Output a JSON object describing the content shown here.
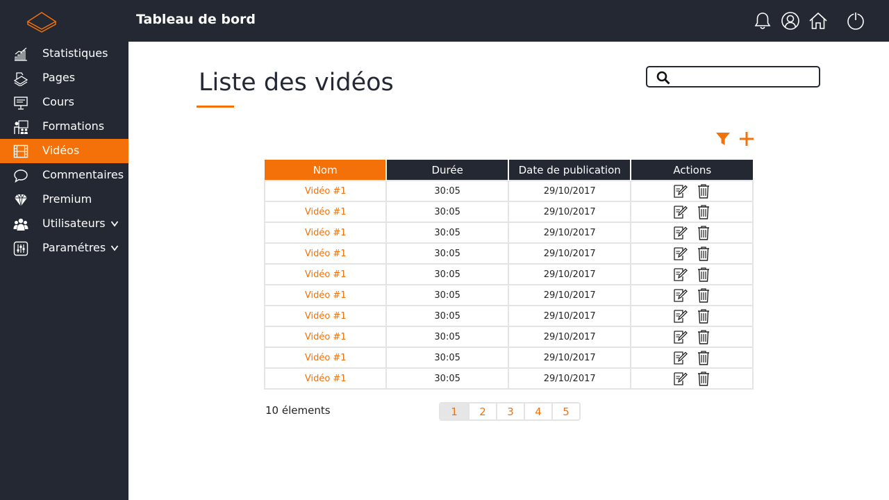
{
  "header": {
    "title": "Tableau de bord"
  },
  "sidebar": {
    "items": [
      {
        "label": "Statistiques",
        "icon": "chart-icon"
      },
      {
        "label": "Pages",
        "icon": "pages-icon"
      },
      {
        "label": "Cours",
        "icon": "presentation-icon"
      },
      {
        "label": "Formations",
        "icon": "training-icon"
      },
      {
        "label": "Vidéos",
        "icon": "film-icon",
        "active": true
      },
      {
        "label": "Commentaires",
        "icon": "comment-icon"
      },
      {
        "label": "Premium",
        "icon": "diamond-icon"
      },
      {
        "label": "Utilisateurs",
        "icon": "users-icon",
        "has_submenu": true
      },
      {
        "label": "Paramétres",
        "icon": "sliders-icon",
        "has_submenu": true
      }
    ]
  },
  "main": {
    "title": "Liste des vidéos",
    "search": {
      "value": "",
      "placeholder": ""
    },
    "table": {
      "headers": [
        "Nom",
        "Durée",
        "Date de publication",
        "Actions"
      ],
      "rows": [
        [
          "Vidéo #1",
          "30:05",
          "29/10/2017"
        ],
        [
          "Vidéo #1",
          "30:05",
          "29/10/2017"
        ],
        [
          "Vidéo #1",
          "30:05",
          "29/10/2017"
        ],
        [
          "Vidéo #1",
          "30:05",
          "29/10/2017"
        ],
        [
          "Vidéo #1",
          "30:05",
          "29/10/2017"
        ],
        [
          "Vidéo #1",
          "30:05",
          "29/10/2017"
        ],
        [
          "Vidéo #1",
          "30:05",
          "29/10/2017"
        ],
        [
          "Vidéo #1",
          "30:05",
          "29/10/2017"
        ],
        [
          "Vidéo #1",
          "30:05",
          "29/10/2017"
        ],
        [
          "Vidéo #1",
          "30:05",
          "29/10/2017"
        ]
      ]
    },
    "count_label": "10 élements",
    "pagination": {
      "pages": [
        "1",
        "2",
        "3",
        "4",
        "5"
      ],
      "current": "1"
    }
  },
  "colors": {
    "accent": "#f37108",
    "dark": "#232833",
    "border": "#e4e4e4"
  }
}
